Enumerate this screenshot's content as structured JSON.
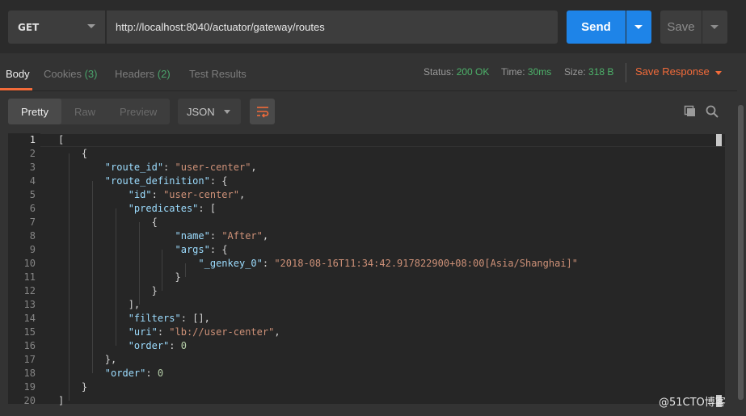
{
  "request": {
    "method": "GET",
    "url": "http://localhost:8040/actuator/gateway/routes",
    "send_label": "Send",
    "save_label": "Save"
  },
  "response_tabs": [
    {
      "label": "Body",
      "count": ""
    },
    {
      "label": "Cookies",
      "count": "(3)"
    },
    {
      "label": "Headers",
      "count": "(2)"
    },
    {
      "label": "Test Results",
      "count": ""
    }
  ],
  "status": {
    "status_label": "Status:",
    "status_value": "200 OK",
    "time_label": "Time:",
    "time_value": "30ms",
    "size_label": "Size:",
    "size_value": "318 B",
    "save_response": "Save Response"
  },
  "view": {
    "modes": [
      "Pretty",
      "Raw",
      "Preview"
    ],
    "format": "JSON"
  },
  "editor": {
    "lines": [
      "[",
      "    {",
      "        \"route_id\": \"user-center\",",
      "        \"route_definition\": {",
      "            \"id\": \"user-center\",",
      "            \"predicates\": [",
      "                {",
      "                    \"name\": \"After\",",
      "                    \"args\": {",
      "                        \"_genkey_0\": \"2018-08-16T11:34:42.917822900+08:00[Asia/Shanghai]\"",
      "                    }",
      "                }",
      "            ],",
      "            \"filters\": [],",
      "            \"uri\": \"lb://user-center\",",
      "            \"order\": 0",
      "        },",
      "        \"order\": 0",
      "    }",
      "]"
    ]
  },
  "watermark": "@51CTO博客",
  "colors": {
    "accent": "#f26b3a",
    "send": "#1e84e8",
    "ok": "#4db26a"
  }
}
